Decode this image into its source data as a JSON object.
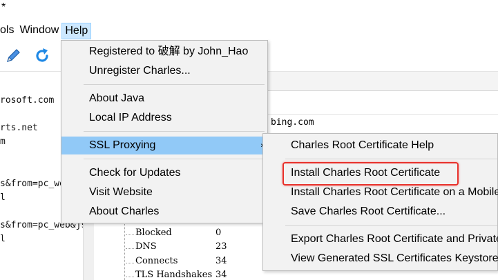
{
  "window": {
    "title_fragment": "*"
  },
  "menubar": {
    "items": [
      {
        "label": "ols",
        "active": false
      },
      {
        "label": "Window",
        "active": false
      },
      {
        "label": "Help",
        "active": true
      }
    ]
  },
  "toolbar": {
    "icons": [
      "edit-icon",
      "refresh-icon"
    ]
  },
  "left_pane": {
    "rows": [
      "rosoft.com",
      "rts.net",
      "m",
      "s&from=pc_we",
      "l",
      "s&from=pc_web&js",
      "l"
    ]
  },
  "detail": {
    "url_fragment": "bing.com",
    "tree": [
      {
        "label": "Blocked",
        "value": "0"
      },
      {
        "label": "DNS",
        "value": "23"
      },
      {
        "label": "Connects",
        "value": "34"
      },
      {
        "label": "TLS Handshakes",
        "value": "34"
      }
    ]
  },
  "help_menu": {
    "items": [
      {
        "label": "Registered to 破解 by John_Hao"
      },
      {
        "label": "Unregister Charles..."
      },
      {
        "label": "About Java"
      },
      {
        "label": "Local IP Address"
      },
      {
        "label": "SSL Proxying",
        "has_submenu": true
      },
      {
        "label": "Check for Updates"
      },
      {
        "label": "Visit Website"
      },
      {
        "label": "About Charles"
      }
    ],
    "submenu_arrow": "›"
  },
  "ssl_submenu": {
    "items": [
      {
        "label": "Charles Root Certificate Help"
      },
      {
        "label": "Install Charles Root Certificate",
        "highlighted_annotation": true
      },
      {
        "label": "Install Charles Root Certificate on a Mobile"
      },
      {
        "label": "Save Charles Root Certificate..."
      },
      {
        "label": "Export Charles Root Certificate and Private"
      },
      {
        "label": "View Generated SSL Certificates Keystore"
      }
    ]
  },
  "colors": {
    "menu_highlight": "#91c9f7",
    "menubar_active": "#cce8ff",
    "annotation_red": "#e8302a",
    "icon_blue": "#1e88e5"
  }
}
